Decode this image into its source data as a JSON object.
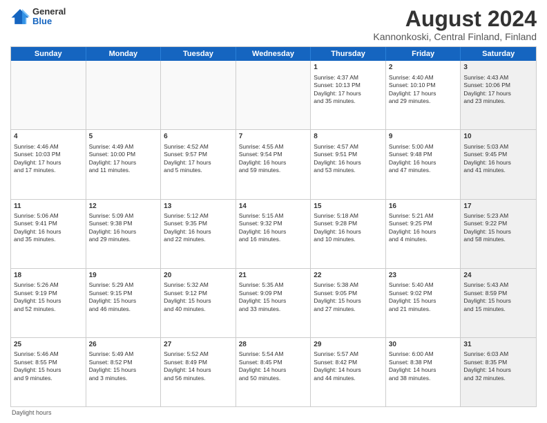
{
  "header": {
    "logo_general": "General",
    "logo_blue": "Blue",
    "main_title": "August 2024",
    "sub_title": "Kannonkoski, Central Finland, Finland"
  },
  "calendar": {
    "days_of_week": [
      "Sunday",
      "Monday",
      "Tuesday",
      "Wednesday",
      "Thursday",
      "Friday",
      "Saturday"
    ],
    "weeks": [
      [
        {
          "day": "",
          "text": "",
          "shaded": true
        },
        {
          "day": "",
          "text": "",
          "shaded": true
        },
        {
          "day": "",
          "text": "",
          "shaded": true
        },
        {
          "day": "",
          "text": "",
          "shaded": true
        },
        {
          "day": "1",
          "text": "Sunrise: 4:37 AM\nSunset: 10:13 PM\nDaylight: 17 hours\nand 35 minutes.",
          "shaded": false
        },
        {
          "day": "2",
          "text": "Sunrise: 4:40 AM\nSunset: 10:10 PM\nDaylight: 17 hours\nand 29 minutes.",
          "shaded": false
        },
        {
          "day": "3",
          "text": "Sunrise: 4:43 AM\nSunset: 10:06 PM\nDaylight: 17 hours\nand 23 minutes.",
          "shaded": true
        }
      ],
      [
        {
          "day": "4",
          "text": "Sunrise: 4:46 AM\nSunset: 10:03 PM\nDaylight: 17 hours\nand 17 minutes.",
          "shaded": false
        },
        {
          "day": "5",
          "text": "Sunrise: 4:49 AM\nSunset: 10:00 PM\nDaylight: 17 hours\nand 11 minutes.",
          "shaded": false
        },
        {
          "day": "6",
          "text": "Sunrise: 4:52 AM\nSunset: 9:57 PM\nDaylight: 17 hours\nand 5 minutes.",
          "shaded": false
        },
        {
          "day": "7",
          "text": "Sunrise: 4:55 AM\nSunset: 9:54 PM\nDaylight: 16 hours\nand 59 minutes.",
          "shaded": false
        },
        {
          "day": "8",
          "text": "Sunrise: 4:57 AM\nSunset: 9:51 PM\nDaylight: 16 hours\nand 53 minutes.",
          "shaded": false
        },
        {
          "day": "9",
          "text": "Sunrise: 5:00 AM\nSunset: 9:48 PM\nDaylight: 16 hours\nand 47 minutes.",
          "shaded": false
        },
        {
          "day": "10",
          "text": "Sunrise: 5:03 AM\nSunset: 9:45 PM\nDaylight: 16 hours\nand 41 minutes.",
          "shaded": true
        }
      ],
      [
        {
          "day": "11",
          "text": "Sunrise: 5:06 AM\nSunset: 9:41 PM\nDaylight: 16 hours\nand 35 minutes.",
          "shaded": false
        },
        {
          "day": "12",
          "text": "Sunrise: 5:09 AM\nSunset: 9:38 PM\nDaylight: 16 hours\nand 29 minutes.",
          "shaded": false
        },
        {
          "day": "13",
          "text": "Sunrise: 5:12 AM\nSunset: 9:35 PM\nDaylight: 16 hours\nand 22 minutes.",
          "shaded": false
        },
        {
          "day": "14",
          "text": "Sunrise: 5:15 AM\nSunset: 9:32 PM\nDaylight: 16 hours\nand 16 minutes.",
          "shaded": false
        },
        {
          "day": "15",
          "text": "Sunrise: 5:18 AM\nSunset: 9:28 PM\nDaylight: 16 hours\nand 10 minutes.",
          "shaded": false
        },
        {
          "day": "16",
          "text": "Sunrise: 5:21 AM\nSunset: 9:25 PM\nDaylight: 16 hours\nand 4 minutes.",
          "shaded": false
        },
        {
          "day": "17",
          "text": "Sunrise: 5:23 AM\nSunset: 9:22 PM\nDaylight: 15 hours\nand 58 minutes.",
          "shaded": true
        }
      ],
      [
        {
          "day": "18",
          "text": "Sunrise: 5:26 AM\nSunset: 9:19 PM\nDaylight: 15 hours\nand 52 minutes.",
          "shaded": false
        },
        {
          "day": "19",
          "text": "Sunrise: 5:29 AM\nSunset: 9:15 PM\nDaylight: 15 hours\nand 46 minutes.",
          "shaded": false
        },
        {
          "day": "20",
          "text": "Sunrise: 5:32 AM\nSunset: 9:12 PM\nDaylight: 15 hours\nand 40 minutes.",
          "shaded": false
        },
        {
          "day": "21",
          "text": "Sunrise: 5:35 AM\nSunset: 9:09 PM\nDaylight: 15 hours\nand 33 minutes.",
          "shaded": false
        },
        {
          "day": "22",
          "text": "Sunrise: 5:38 AM\nSunset: 9:05 PM\nDaylight: 15 hours\nand 27 minutes.",
          "shaded": false
        },
        {
          "day": "23",
          "text": "Sunrise: 5:40 AM\nSunset: 9:02 PM\nDaylight: 15 hours\nand 21 minutes.",
          "shaded": false
        },
        {
          "day": "24",
          "text": "Sunrise: 5:43 AM\nSunset: 8:59 PM\nDaylight: 15 hours\nand 15 minutes.",
          "shaded": true
        }
      ],
      [
        {
          "day": "25",
          "text": "Sunrise: 5:46 AM\nSunset: 8:55 PM\nDaylight: 15 hours\nand 9 minutes.",
          "shaded": false
        },
        {
          "day": "26",
          "text": "Sunrise: 5:49 AM\nSunset: 8:52 PM\nDaylight: 15 hours\nand 3 minutes.",
          "shaded": false
        },
        {
          "day": "27",
          "text": "Sunrise: 5:52 AM\nSunset: 8:49 PM\nDaylight: 14 hours\nand 56 minutes.",
          "shaded": false
        },
        {
          "day": "28",
          "text": "Sunrise: 5:54 AM\nSunset: 8:45 PM\nDaylight: 14 hours\nand 50 minutes.",
          "shaded": false
        },
        {
          "day": "29",
          "text": "Sunrise: 5:57 AM\nSunset: 8:42 PM\nDaylight: 14 hours\nand 44 minutes.",
          "shaded": false
        },
        {
          "day": "30",
          "text": "Sunrise: 6:00 AM\nSunset: 8:38 PM\nDaylight: 14 hours\nand 38 minutes.",
          "shaded": false
        },
        {
          "day": "31",
          "text": "Sunrise: 6:03 AM\nSunset: 8:35 PM\nDaylight: 14 hours\nand 32 minutes.",
          "shaded": true
        }
      ]
    ]
  },
  "footer": {
    "note": "Daylight hours"
  }
}
